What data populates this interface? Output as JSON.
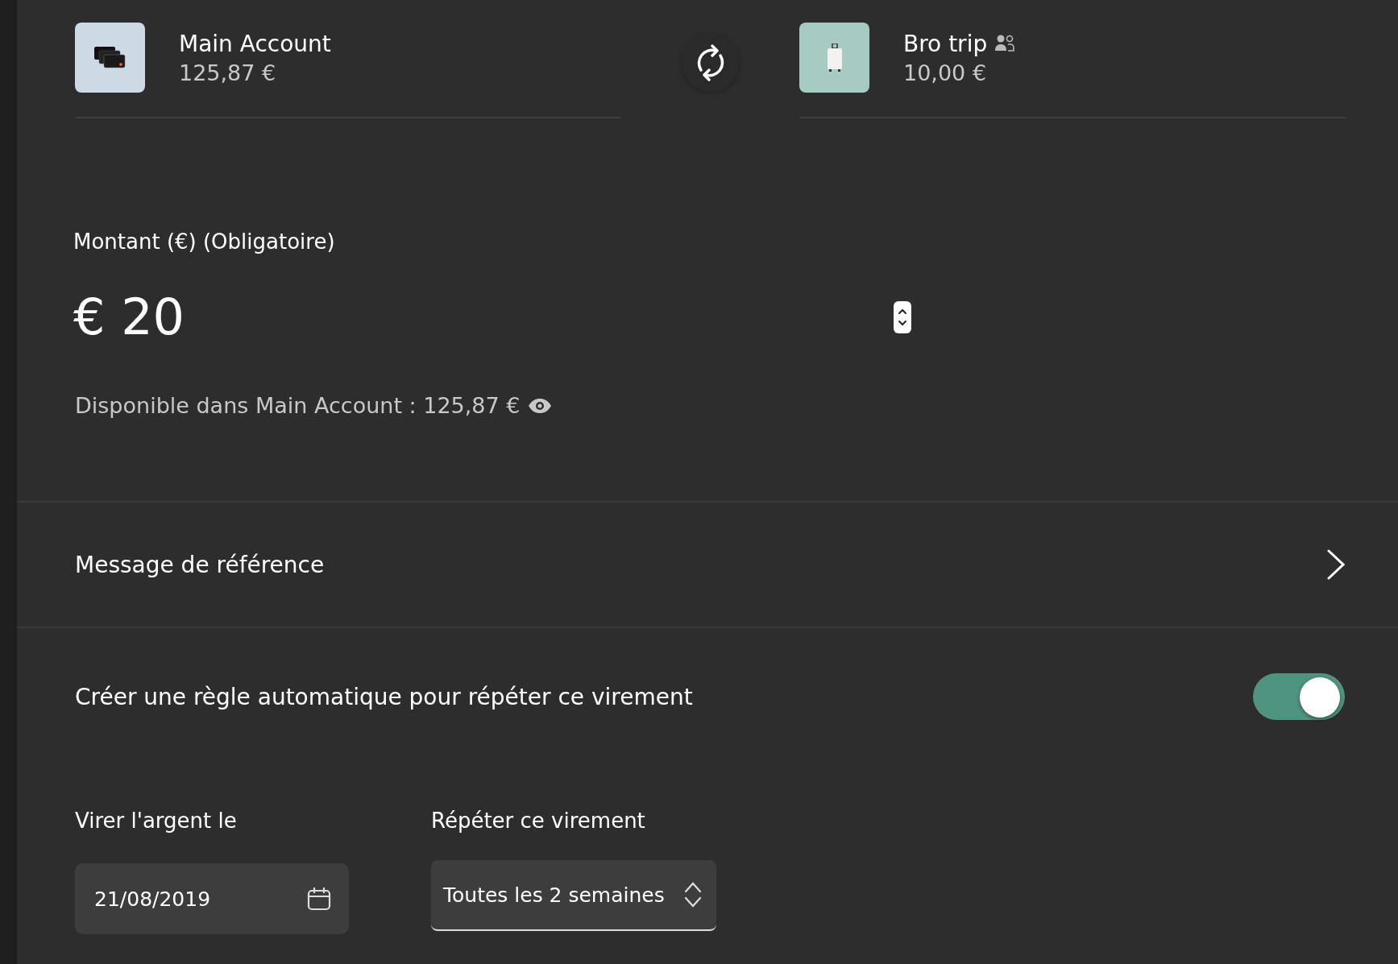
{
  "transfer": {
    "from": {
      "name": "Main Account",
      "balance": "125,87 €",
      "kind": "cards"
    },
    "to": {
      "name": "Bro trip",
      "balance": "10,00 €",
      "kind": "luggage",
      "shared": true
    }
  },
  "amount": {
    "label": "Montant (€) (Obligatoire)",
    "currency": "€",
    "value": "20",
    "available": "Disponible dans Main Account : 125,87 €"
  },
  "reference": {
    "label": "Message de référence"
  },
  "recurring": {
    "label": "Créer une règle automatique pour répéter ce virement",
    "on": true
  },
  "date_field": {
    "label": "Virer l'argent le",
    "value": "21/08/2019"
  },
  "repeat_field": {
    "label": "Répéter ce virement",
    "value": "Toutes les 2 semaines"
  }
}
